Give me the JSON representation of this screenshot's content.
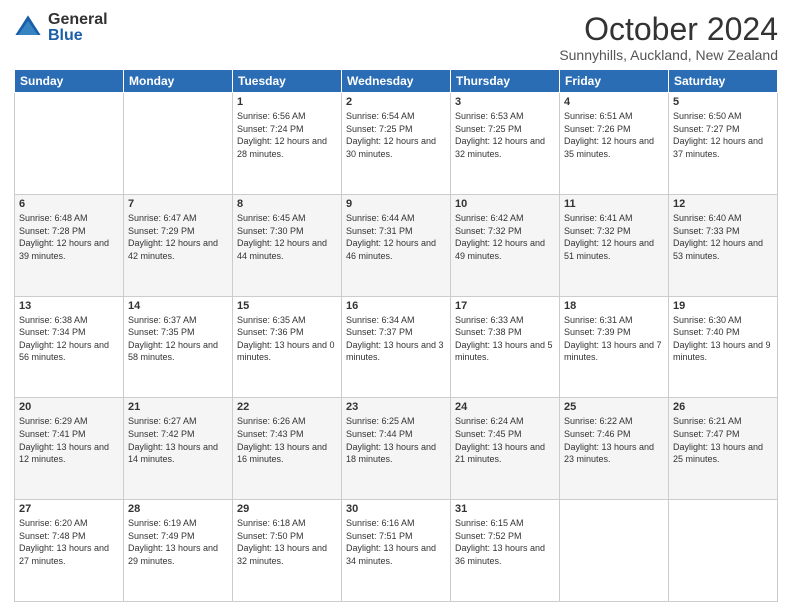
{
  "logo": {
    "general": "General",
    "blue": "Blue"
  },
  "header": {
    "month": "October 2024",
    "location": "Sunnyhills, Auckland, New Zealand"
  },
  "days_of_week": [
    "Sunday",
    "Monday",
    "Tuesday",
    "Wednesday",
    "Thursday",
    "Friday",
    "Saturday"
  ],
  "weeks": [
    [
      {
        "day": "",
        "info": ""
      },
      {
        "day": "",
        "info": ""
      },
      {
        "day": "1",
        "info": "Sunrise: 6:56 AM\nSunset: 7:24 PM\nDaylight: 12 hours and 28 minutes."
      },
      {
        "day": "2",
        "info": "Sunrise: 6:54 AM\nSunset: 7:25 PM\nDaylight: 12 hours and 30 minutes."
      },
      {
        "day": "3",
        "info": "Sunrise: 6:53 AM\nSunset: 7:25 PM\nDaylight: 12 hours and 32 minutes."
      },
      {
        "day": "4",
        "info": "Sunrise: 6:51 AM\nSunset: 7:26 PM\nDaylight: 12 hours and 35 minutes."
      },
      {
        "day": "5",
        "info": "Sunrise: 6:50 AM\nSunset: 7:27 PM\nDaylight: 12 hours and 37 minutes."
      }
    ],
    [
      {
        "day": "6",
        "info": "Sunrise: 6:48 AM\nSunset: 7:28 PM\nDaylight: 12 hours and 39 minutes."
      },
      {
        "day": "7",
        "info": "Sunrise: 6:47 AM\nSunset: 7:29 PM\nDaylight: 12 hours and 42 minutes."
      },
      {
        "day": "8",
        "info": "Sunrise: 6:45 AM\nSunset: 7:30 PM\nDaylight: 12 hours and 44 minutes."
      },
      {
        "day": "9",
        "info": "Sunrise: 6:44 AM\nSunset: 7:31 PM\nDaylight: 12 hours and 46 minutes."
      },
      {
        "day": "10",
        "info": "Sunrise: 6:42 AM\nSunset: 7:32 PM\nDaylight: 12 hours and 49 minutes."
      },
      {
        "day": "11",
        "info": "Sunrise: 6:41 AM\nSunset: 7:32 PM\nDaylight: 12 hours and 51 minutes."
      },
      {
        "day": "12",
        "info": "Sunrise: 6:40 AM\nSunset: 7:33 PM\nDaylight: 12 hours and 53 minutes."
      }
    ],
    [
      {
        "day": "13",
        "info": "Sunrise: 6:38 AM\nSunset: 7:34 PM\nDaylight: 12 hours and 56 minutes."
      },
      {
        "day": "14",
        "info": "Sunrise: 6:37 AM\nSunset: 7:35 PM\nDaylight: 12 hours and 58 minutes."
      },
      {
        "day": "15",
        "info": "Sunrise: 6:35 AM\nSunset: 7:36 PM\nDaylight: 13 hours and 0 minutes."
      },
      {
        "day": "16",
        "info": "Sunrise: 6:34 AM\nSunset: 7:37 PM\nDaylight: 13 hours and 3 minutes."
      },
      {
        "day": "17",
        "info": "Sunrise: 6:33 AM\nSunset: 7:38 PM\nDaylight: 13 hours and 5 minutes."
      },
      {
        "day": "18",
        "info": "Sunrise: 6:31 AM\nSunset: 7:39 PM\nDaylight: 13 hours and 7 minutes."
      },
      {
        "day": "19",
        "info": "Sunrise: 6:30 AM\nSunset: 7:40 PM\nDaylight: 13 hours and 9 minutes."
      }
    ],
    [
      {
        "day": "20",
        "info": "Sunrise: 6:29 AM\nSunset: 7:41 PM\nDaylight: 13 hours and 12 minutes."
      },
      {
        "day": "21",
        "info": "Sunrise: 6:27 AM\nSunset: 7:42 PM\nDaylight: 13 hours and 14 minutes."
      },
      {
        "day": "22",
        "info": "Sunrise: 6:26 AM\nSunset: 7:43 PM\nDaylight: 13 hours and 16 minutes."
      },
      {
        "day": "23",
        "info": "Sunrise: 6:25 AM\nSunset: 7:44 PM\nDaylight: 13 hours and 18 minutes."
      },
      {
        "day": "24",
        "info": "Sunrise: 6:24 AM\nSunset: 7:45 PM\nDaylight: 13 hours and 21 minutes."
      },
      {
        "day": "25",
        "info": "Sunrise: 6:22 AM\nSunset: 7:46 PM\nDaylight: 13 hours and 23 minutes."
      },
      {
        "day": "26",
        "info": "Sunrise: 6:21 AM\nSunset: 7:47 PM\nDaylight: 13 hours and 25 minutes."
      }
    ],
    [
      {
        "day": "27",
        "info": "Sunrise: 6:20 AM\nSunset: 7:48 PM\nDaylight: 13 hours and 27 minutes."
      },
      {
        "day": "28",
        "info": "Sunrise: 6:19 AM\nSunset: 7:49 PM\nDaylight: 13 hours and 29 minutes."
      },
      {
        "day": "29",
        "info": "Sunrise: 6:18 AM\nSunset: 7:50 PM\nDaylight: 13 hours and 32 minutes."
      },
      {
        "day": "30",
        "info": "Sunrise: 6:16 AM\nSunset: 7:51 PM\nDaylight: 13 hours and 34 minutes."
      },
      {
        "day": "31",
        "info": "Sunrise: 6:15 AM\nSunset: 7:52 PM\nDaylight: 13 hours and 36 minutes."
      },
      {
        "day": "",
        "info": ""
      },
      {
        "day": "",
        "info": ""
      }
    ]
  ]
}
